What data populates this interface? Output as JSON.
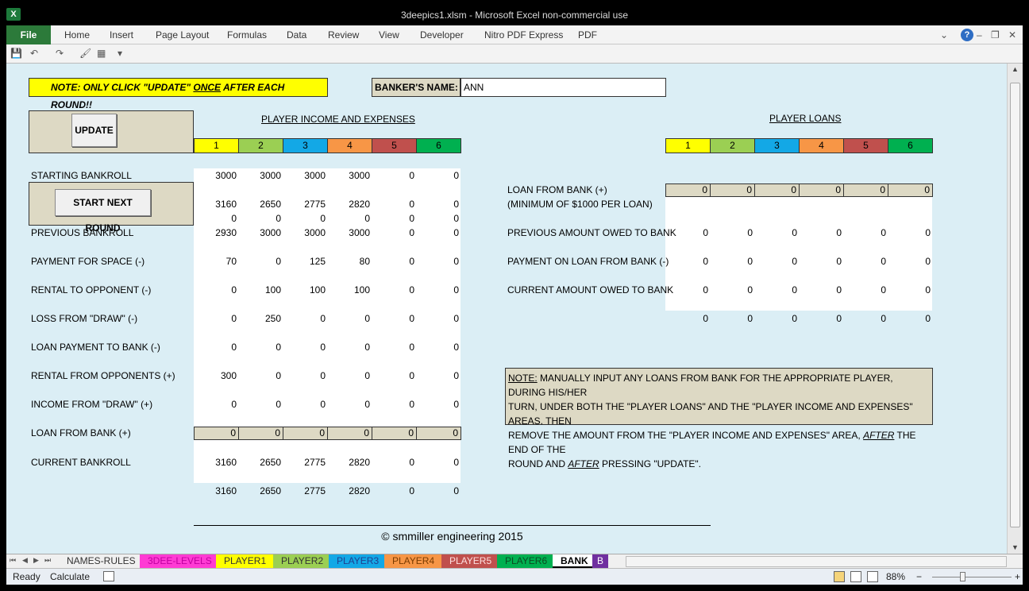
{
  "window": {
    "title": "3deepics1.xlsm  -  Microsoft Excel non-commercial use",
    "app_icon": "X",
    "controls": {
      "min": "–",
      "restore": "❐",
      "close": "✕"
    }
  },
  "ribbon": {
    "file": "File",
    "tabs": [
      "Home",
      "Insert",
      "Page Layout",
      "Formulas",
      "Data",
      "Review",
      "View",
      "Developer",
      "Nitro PDF Express",
      "PDF"
    ],
    "chevron": "⌄",
    "help": "?",
    "min": "–",
    "restore": "❐",
    "close": "✕"
  },
  "qat": {
    "save": "💾",
    "undo": "↶",
    "redo": "↷",
    "brush": "🖌",
    "form": "▦",
    "more": "▾"
  },
  "sheet": {
    "note": {
      "pre": "NOTE:  ONLY CLICK \"UPDATE\" ",
      "once": "ONCE",
      "post": " AFTER EACH ROUND!!"
    },
    "banker_label": "BANKER'S NAME:",
    "banker_value": "ANN",
    "update_button": "UPDATE",
    "start_button": "START NEXT ROUND",
    "income_title": "PLAYER INCOME AND EXPENSES",
    "loans_title": "PLAYER LOANS",
    "players": [
      "1",
      "2",
      "3",
      "4",
      "5",
      "6"
    ],
    "player_colors": [
      "#ffff00",
      "#9bcf53",
      "#13a8e6",
      "#f79646",
      "#c0504d",
      "#00b050"
    ],
    "rows": [
      {
        "label": "STARTING BANKROLL",
        "values": [
          "3000",
          "3000",
          "3000",
          "3000",
          "0",
          "0"
        ]
      },
      {
        "label": "",
        "values": [
          "3160",
          "2650",
          "2775",
          "2820",
          "0",
          "0"
        ]
      },
      {
        "label": "",
        "values": [
          "0",
          "0",
          "0",
          "0",
          "0",
          "0"
        ]
      },
      {
        "label": "PREVIOUS BANKROLL",
        "values": [
          "2930",
          "3000",
          "3000",
          "3000",
          "0",
          "0"
        ]
      },
      {
        "label": "PAYMENT FOR SPACE (-)",
        "values": [
          "70",
          "0",
          "125",
          "80",
          "0",
          "0"
        ]
      },
      {
        "label": "RENTAL TO OPPONENT (-)",
        "values": [
          "0",
          "100",
          "100",
          "100",
          "0",
          "0"
        ]
      },
      {
        "label": "LOSS FROM \"DRAW\" (-)",
        "values": [
          "0",
          "250",
          "0",
          "0",
          "0",
          "0"
        ]
      },
      {
        "label": "LOAN PAYMENT TO BANK (-)",
        "values": [
          "0",
          "0",
          "0",
          "0",
          "0",
          "0"
        ]
      },
      {
        "label": "RENTAL FROM OPPONENTS (+)",
        "values": [
          "300",
          "0",
          "0",
          "0",
          "0",
          "0"
        ]
      },
      {
        "label": "INCOME FROM \"DRAW\" (+)",
        "values": [
          "0",
          "0",
          "0",
          "0",
          "0",
          "0"
        ]
      },
      {
        "label": "LOAN FROM BANK (+)",
        "values": [
          "0",
          "0",
          "0",
          "0",
          "0",
          "0"
        ]
      },
      {
        "label": "CURRENT BANKROLL",
        "values": [
          "3160",
          "2650",
          "2775",
          "2820",
          "0",
          "0"
        ]
      },
      {
        "label": "",
        "values": [
          "3160",
          "2650",
          "2775",
          "2820",
          "0",
          "0"
        ]
      }
    ],
    "loan_rows": [
      {
        "label": "LOAN FROM BANK (+)",
        "values": [
          "0",
          "0",
          "0",
          "0",
          "0",
          "0"
        ]
      },
      {
        "label": "(MINIMUM OF $1000 PER LOAN)",
        "values": []
      },
      {
        "label": "PREVIOUS AMOUNT OWED TO BANK",
        "values": [
          "0",
          "0",
          "0",
          "0",
          "0",
          "0"
        ]
      },
      {
        "label": "PAYMENT ON LOAN FROM BANK (-)",
        "values": [
          "0",
          "0",
          "0",
          "0",
          "0",
          "0"
        ]
      },
      {
        "label": "CURRENT AMOUNT OWED TO BANK",
        "values": [
          "0",
          "0",
          "0",
          "0",
          "0",
          "0"
        ]
      },
      {
        "label": "",
        "values": [
          "0",
          "0",
          "0",
          "0",
          "0",
          "0"
        ]
      }
    ],
    "notebox": {
      "note": "NOTE:",
      "l1": "  MANUALLY INPUT ANY LOANS FROM BANK FOR THE APPROPRIATE PLAYER, DURING HIS/HER",
      "l2": "TURN, UNDER BOTH THE \"PLAYER LOANS\" AND THE \"PLAYER INCOME AND EXPENSES\" AREAS.  THEN",
      "l3a": "REMOVE THE AMOUNT FROM THE \"PLAYER INCOME AND EXPENSES\" AREA,  ",
      "after": "AFTER",
      "l3b": "  THE END OF THE",
      "l4a": "ROUND AND ",
      "after2": "AFTER",
      "l4b": "  PRESSING \"UPDATE\"."
    },
    "copyright": "© smmiller engineering 2015"
  },
  "sheet_tabs": [
    {
      "name": "NAMES-RULES",
      "bg": "#f0f0f0",
      "color": "#333"
    },
    {
      "name": "3DEE-LEVELS",
      "bg": "#ff3bd4",
      "color": "#c000a0"
    },
    {
      "name": "PLAYER1",
      "bg": "#ffff00",
      "color": "#333"
    },
    {
      "name": "PLAYER2",
      "bg": "#9bcf53",
      "color": "#333"
    },
    {
      "name": "PLAYER3",
      "bg": "#13a8e6",
      "color": "#1f3f8f"
    },
    {
      "name": "PLAYER4",
      "bg": "#f79646",
      "color": "#7a3b00"
    },
    {
      "name": "PLAYER5",
      "bg": "#c0504d",
      "color": "#fde0e0"
    },
    {
      "name": "PLAYER6",
      "bg": "#00b050",
      "color": "#0b4a22"
    },
    {
      "name": "BANK",
      "bg": "#ffffff",
      "color": "#000"
    },
    {
      "name": "B",
      "bg": "#7030a0",
      "color": "#fff"
    }
  ],
  "nav": {
    "first": "⏮",
    "prev": "◀",
    "next": "▶",
    "last": "⏭"
  },
  "status": {
    "ready": "Ready",
    "calculate": "Calculate",
    "zoom": "88%",
    "minus": "−",
    "plus": "+"
  }
}
